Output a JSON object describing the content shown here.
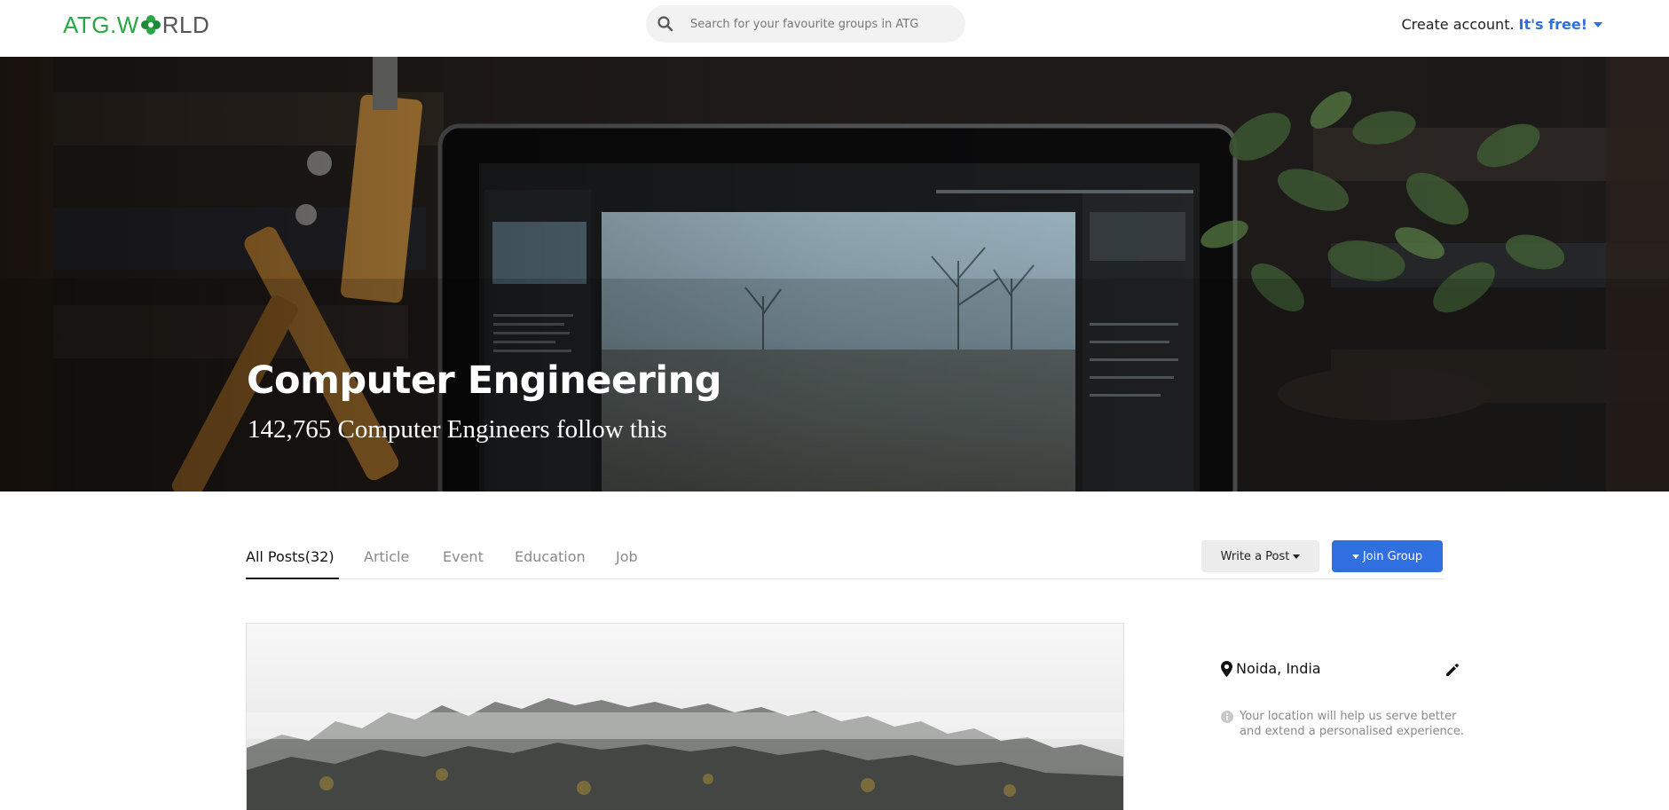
{
  "header": {
    "logo_text_a": "ATG.W",
    "logo_text_b": "RLD",
    "search_placeholder": "Search for your favourite groups in ATG",
    "account_text": "Create account.",
    "account_free": "It's free!"
  },
  "hero": {
    "title": "Computer Engineering",
    "subtitle": "142,765 Computer Engineers follow this"
  },
  "tabs": [
    {
      "label": "All Posts(32)"
    },
    {
      "label": "Article"
    },
    {
      "label": "Event"
    },
    {
      "label": "Education"
    },
    {
      "label": "Job"
    }
  ],
  "actions": {
    "write_post": "Write a Post",
    "join_group": "Join Group"
  },
  "sidebar": {
    "location": "Noida, India",
    "location_hint": "Your location will help us serve better and extend a personalised experience."
  },
  "colors": {
    "brand_green": "#27a844",
    "accent_blue": "#2f6fe0"
  }
}
